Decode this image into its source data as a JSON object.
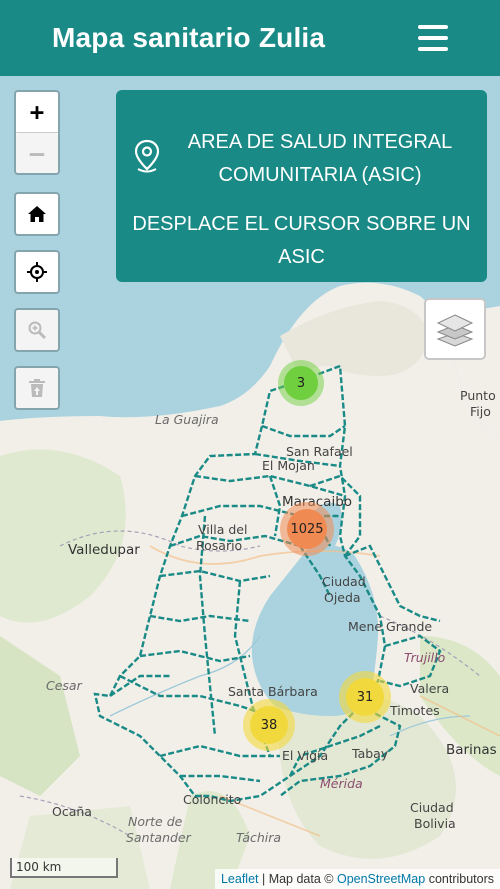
{
  "header": {
    "title": "Mapa sanitario Zulia",
    "menu_icon": "hamburger-menu-icon"
  },
  "controls": {
    "zoom_in": "+",
    "zoom_out": "—",
    "home_icon": "home-icon",
    "locate_icon": "crosshair-icon",
    "zoom_search_icon": "zoom-search-icon",
    "delete_icon": "trash-icon",
    "layers_icon": "layers-icon"
  },
  "info_panel": {
    "title": "AREA DE SALUD INTEGRAL COMUNITARIA (ASIC)",
    "hint": "DESPLACE EL CURSOR SOBRE UN ASIC",
    "icon": "location-pin-icon"
  },
  "clusters": [
    {
      "count": "3",
      "color": "#6fcf3f"
    },
    {
      "count": "1025",
      "color": "#f08a53"
    },
    {
      "count": "31",
      "color": "#f1d83c"
    },
    {
      "count": "38",
      "color": "#f1d83c"
    }
  ],
  "map_labels": {
    "la_guajira": "La Guajira",
    "san_rafael": "San Rafael",
    "el_mojan": "El Mojan",
    "maracaibo": "Maracaibo",
    "valledupar": "Valledupar",
    "villa_del_rosario_1": "Villa del",
    "villa_del_rosario_2": "Rosario",
    "ciudad_ojeda_1": "Ciudad",
    "ciudad_ojeda_2": "Ojeda",
    "mene_grande": "Mene Grande",
    "trujillo": "Trujillo",
    "cesar": "Cesar",
    "santa_barbara": "Santa Bárbara",
    "valera": "Valera",
    "timotes": "Timotes",
    "tabay": "Tabay",
    "barinas": "Barinas",
    "el_vigia": "El Vigía",
    "merida": "Mérida",
    "ocana": "Ocaña",
    "colon": "Colon",
    "colon_cito": "Coloncito",
    "norte_de_santander_1": "Norte de",
    "norte_de_santander_2": "Santander",
    "tachira": "Táchira",
    "ciudad_bolivia_1": "Ciudad",
    "ciudad_bolivia_2": "Bolivia",
    "punto_fijo_1": "Punto",
    "punto_fijo_2": "Fijo"
  },
  "scale": "100 km",
  "attribution": {
    "leaflet": "Leaflet",
    "sep": " | Map data © ",
    "osm": "OpenStreetMap",
    "suffix": " contributors"
  },
  "colors": {
    "header_bg": "#1a8a86",
    "sea": "#aad3df",
    "land": "#f2efe9",
    "boundary": "#1a8a86"
  }
}
